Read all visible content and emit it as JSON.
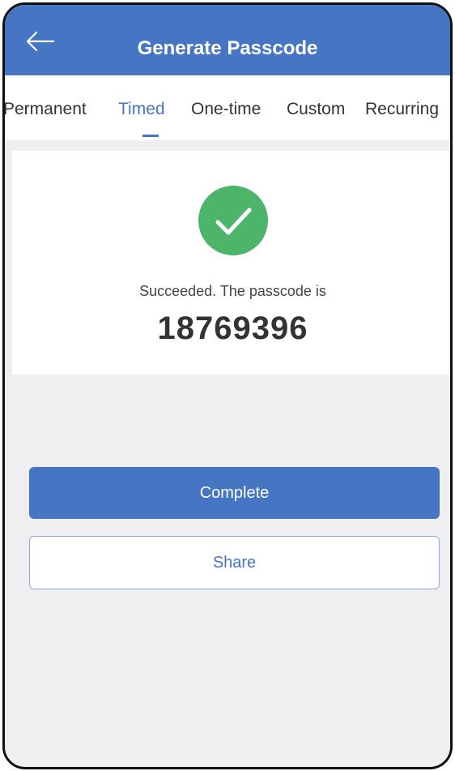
{
  "header": {
    "title": "Generate Passcode",
    "back_icon": "arrow-left-icon",
    "color": "#4676c3"
  },
  "tabs": [
    {
      "label": "Permanent",
      "active": false
    },
    {
      "label": "Timed",
      "active": true
    },
    {
      "label": "One-time",
      "active": false
    },
    {
      "label": "Custom",
      "active": false
    },
    {
      "label": "Recurring",
      "active": false
    }
  ],
  "result": {
    "icon": "check-circle-icon",
    "icon_color": "#4cb56a",
    "message": "Succeeded. The passcode is",
    "passcode": "18769396"
  },
  "actions": {
    "complete_label": "Complete",
    "share_label": "Share"
  }
}
